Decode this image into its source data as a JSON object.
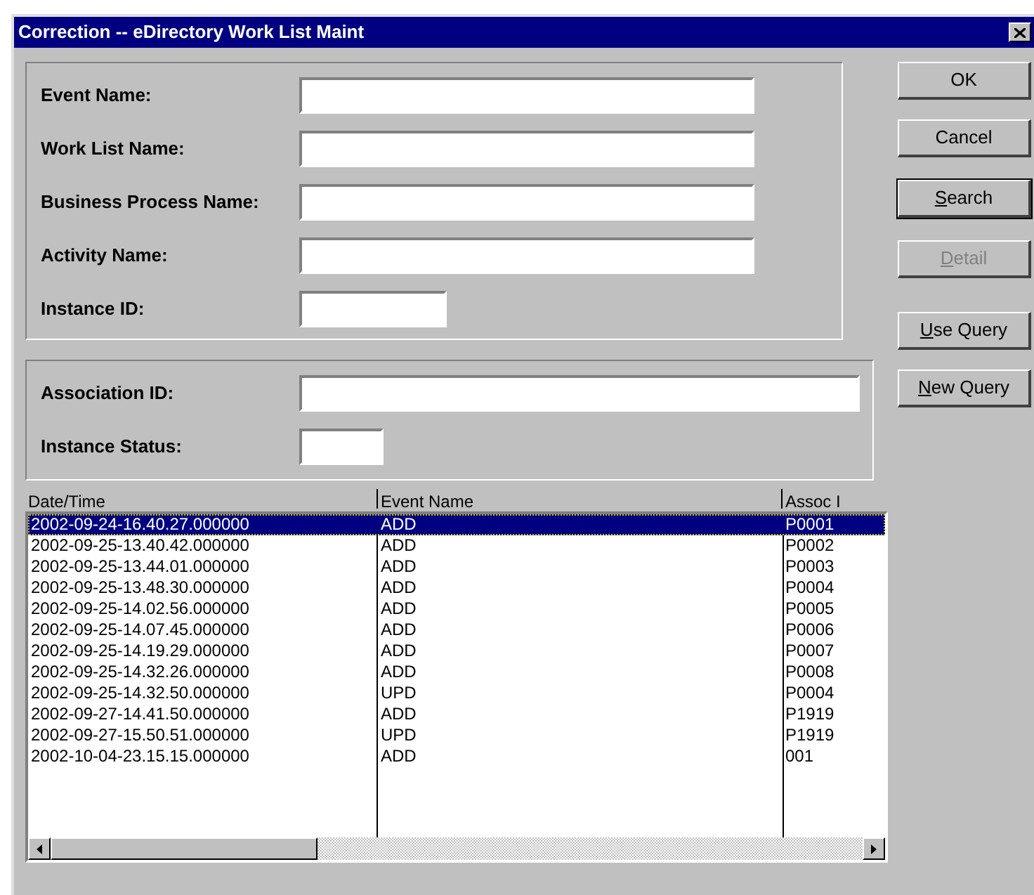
{
  "window": {
    "title": "Correction -- eDirectory Work List Maint"
  },
  "criteria": [
    {
      "label": "Event Name:"
    },
    {
      "label": "Work List Name:"
    },
    {
      "label": "Business Process Name:"
    },
    {
      "label": "Activity Name:"
    },
    {
      "label": "Instance ID:"
    }
  ],
  "association": [
    {
      "label": "Association ID:"
    },
    {
      "label": "Instance Status:"
    }
  ],
  "buttons": [
    {
      "label": "OK",
      "default": false,
      "disabled": false,
      "mnemonic": false
    },
    {
      "label": "Cancel",
      "default": false,
      "disabled": false,
      "mnemonic": false
    },
    {
      "label": "Search",
      "default": true,
      "disabled": false,
      "mnemonic": true
    },
    {
      "label": "Detail",
      "default": false,
      "disabled": true,
      "mnemonic": true
    },
    {
      "label": "Use Query",
      "default": false,
      "disabled": false,
      "mnemonic": true
    },
    {
      "label": "New Query",
      "default": false,
      "disabled": false,
      "mnemonic": true
    }
  ],
  "list": {
    "columns": [
      "Date/Time",
      "Event Name",
      "Assoc I"
    ],
    "rows": [
      {
        "cells": [
          "2002-09-24-16.40.27.000000",
          "ADD",
          "P0001"
        ],
        "selected": true
      },
      {
        "cells": [
          "2002-09-25-13.40.42.000000",
          "ADD",
          "P0002"
        ],
        "selected": false
      },
      {
        "cells": [
          "2002-09-25-13.44.01.000000",
          "ADD",
          "P0003"
        ],
        "selected": false
      },
      {
        "cells": [
          "2002-09-25-13.48.30.000000",
          "ADD",
          "P0004"
        ],
        "selected": false
      },
      {
        "cells": [
          "2002-09-25-14.02.56.000000",
          "ADD",
          "P0005"
        ],
        "selected": false
      },
      {
        "cells": [
          "2002-09-25-14.07.45.000000",
          "ADD",
          "P0006"
        ],
        "selected": false
      },
      {
        "cells": [
          "2002-09-25-14.19.29.000000",
          "ADD",
          "P0007"
        ],
        "selected": false
      },
      {
        "cells": [
          "2002-09-25-14.32.26.000000",
          "ADD",
          "P0008"
        ],
        "selected": false
      },
      {
        "cells": [
          "2002-09-25-14.32.50.000000",
          "UPD",
          "P0004"
        ],
        "selected": false
      },
      {
        "cells": [
          "2002-09-27-14.41.50.000000",
          "ADD",
          "P1919"
        ],
        "selected": false
      },
      {
        "cells": [
          "2002-09-27-15.50.51.000000",
          "UPD",
          "P1919"
        ],
        "selected": false
      },
      {
        "cells": [
          "2002-10-04-23.15.15.000000",
          "ADD",
          "001"
        ],
        "selected": false
      }
    ]
  }
}
